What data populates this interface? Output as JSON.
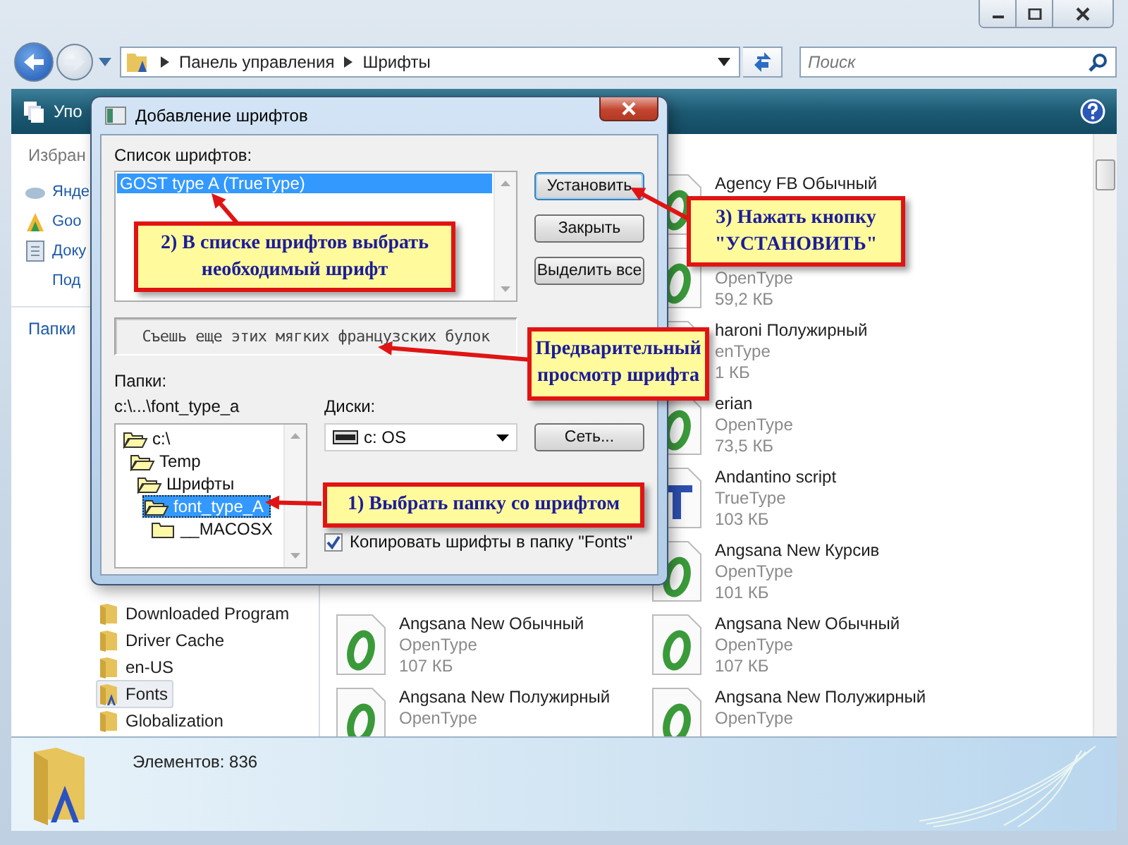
{
  "address": {
    "path": [
      "Панель управления",
      "Шрифты"
    ]
  },
  "search": {
    "placeholder": "Поиск"
  },
  "toolbar": {
    "organize": "Упо"
  },
  "sidebar": {
    "heading": "Избран",
    "links": [
      {
        "label": "Янде",
        "kind": "cloud"
      },
      {
        "label": "Goo",
        "kind": "drive"
      },
      {
        "label": "Доку",
        "kind": "document"
      },
      {
        "label": "Под",
        "kind": "plain"
      }
    ],
    "folders_heading": "Папки",
    "tree": [
      {
        "label": "Downloaded Program",
        "kind": "folder",
        "selected": false
      },
      {
        "label": "Driver Cache",
        "kind": "folder",
        "selected": false
      },
      {
        "label": "en-US",
        "kind": "folder",
        "selected": false
      },
      {
        "label": "Fonts",
        "kind": "fonts",
        "selected": true
      },
      {
        "label": "Globalization",
        "kind": "folder",
        "selected": false
      }
    ]
  },
  "files": {
    "column_1": [
      {
        "kind": "opentype",
        "name": "Angsana New Обычный",
        "type": "OpenType",
        "size": "107 КБ"
      },
      {
        "kind": "opentype",
        "name": "Angsana New Полужирный",
        "type": "OpenType"
      }
    ],
    "column_2": [
      {
        "kind": "opentype",
        "name": "Agency FB Обычный"
      },
      {
        "kind": "opentype",
        "type": "OpenType",
        "size": "59,2 КБ"
      },
      {
        "kind": "opentype",
        "name": "haroni Полужирный",
        "type": "enType",
        "size": "1 КБ"
      },
      {
        "kind": "opentype",
        "name": "erian",
        "type": "OpenType",
        "size": "73,5 КБ"
      },
      {
        "kind": "truetype",
        "name": "Andantino script",
        "type": "TrueType",
        "size": "103 КБ"
      },
      {
        "kind": "opentype",
        "name": "Angsana New Курсив",
        "type": "OpenType",
        "size": "101 КБ"
      },
      {
        "kind": "opentype",
        "name": "Angsana New Обычный",
        "type": "OpenType",
        "size": "107 КБ"
      },
      {
        "kind": "opentype",
        "name": "Angsana New Полужирный",
        "type": "OpenType"
      }
    ]
  },
  "status": {
    "count": "Элементов: 836"
  },
  "dialog": {
    "title": "Добавление шрифтов",
    "list_label": "Список шрифтов:",
    "fonts": [
      {
        "label": "GOST type A (TrueType)",
        "selected": true
      }
    ],
    "buttons": [
      {
        "label": "Установить",
        "default": true
      },
      {
        "label": "Закрыть",
        "default": false
      },
      {
        "label": "Выделить все",
        "default": false
      }
    ],
    "preview": "Съешь еще этих мягких французских булок",
    "folders_label": "Папки:",
    "current_path": "c:\\...\\font_type_a",
    "folders": [
      {
        "label": "c:\\",
        "selected": false,
        "children": [
          {
            "label": "Temp",
            "selected": false,
            "children": [
              {
                "label": "Шрифты",
                "selected": false,
                "children": [
                  {
                    "label": "font_type_A",
                    "selected": true,
                    "children": [
                      {
                        "label": "__MACOSX",
                        "selected": false
                      }
                    ]
                  }
                ]
              }
            ]
          }
        ]
      }
    ],
    "drives_label": "Диски:",
    "drive": "c: OS",
    "network_button": "Сеть...",
    "copy_option": {
      "label": "Копировать шрифты в папку \"Fonts\"",
      "checked": true
    }
  },
  "callouts": [
    {
      "lines": [
        "3) Нажать кнопку",
        "\"УСТАНОВИТЬ\""
      ]
    },
    {
      "lines": [
        "2) В списке шрифтов выбрать",
        "необходимый шрифт"
      ]
    },
    {
      "lines": [
        "Предварительный",
        "просмотр шрифта"
      ]
    },
    {
      "lines": [
        "1) Выбрать папку со шрифтом"
      ]
    }
  ]
}
